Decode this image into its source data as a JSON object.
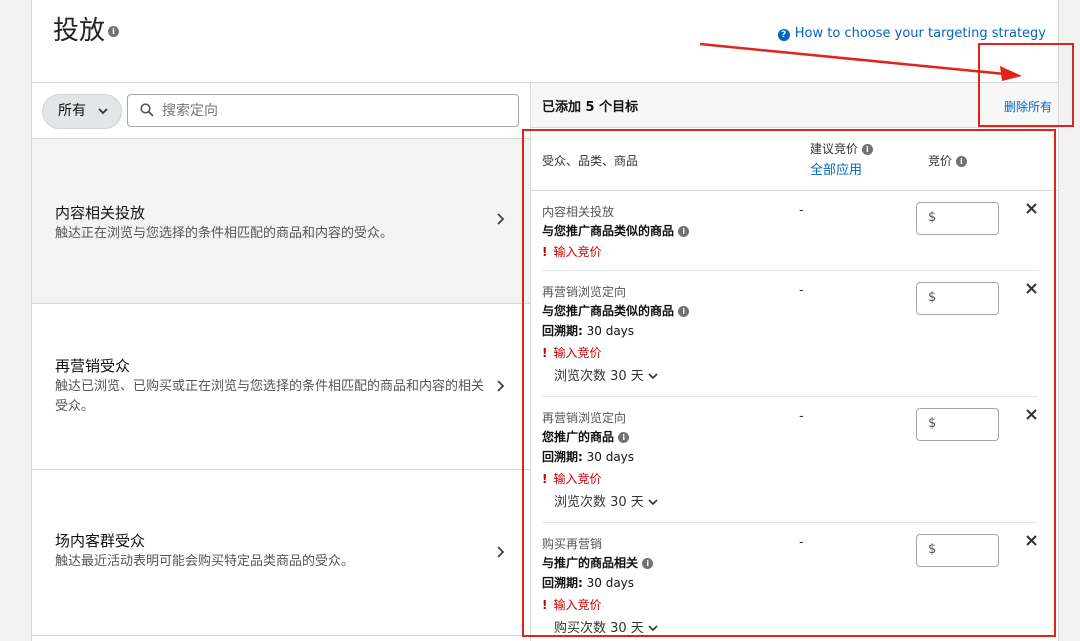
{
  "header": {
    "title": "投放",
    "help_link": "How to choose your targeting strategy"
  },
  "filter": {
    "all_label": "所有",
    "search_placeholder": "搜索定向"
  },
  "categories": [
    {
      "name": "内容相关投放",
      "desc": "触达正在浏览与您选择的条件相匹配的商品和内容的受众。"
    },
    {
      "name": "再营销受众",
      "desc": "触达已浏览、已购买或正在浏览与您选择的条件相匹配的商品和内容的相关受众。"
    },
    {
      "name": "场内客群受众",
      "desc": "触达最近活动表明可能会购买特定品类商品的受众。"
    }
  ],
  "added_panel": {
    "added_label": "已添加 5 个目标",
    "remove_all": "删除所有",
    "col_target": "受众、品类、商品",
    "col_suggested": "建议竞价",
    "apply_all": "全部应用",
    "col_bid": "竞价"
  },
  "rows": [
    {
      "type": "内容相关投放",
      "target": "与您推广商品类似的商品",
      "lookback_label": "",
      "lookback_value": "",
      "error": "输入竞价",
      "freq": "",
      "suggested": "-",
      "currency": "$"
    },
    {
      "type": "再营销浏览定向",
      "target": "与您推广商品类似的商品",
      "lookback_label": "回溯期:",
      "lookback_value": " 30 days",
      "error": "输入竞价",
      "freq": "浏览次数 30 天",
      "suggested": "-",
      "currency": "$"
    },
    {
      "type": "再营销浏览定向",
      "target": "您推广的商品",
      "lookback_label": "回溯期:",
      "lookback_value": " 30 days",
      "error": "输入竞价",
      "freq": "浏览次数 30 天",
      "suggested": "-",
      "currency": "$"
    },
    {
      "type": "购买再营销",
      "target": "与推广的商品相关",
      "lookback_label": "回溯期:",
      "lookback_value": " 30 days",
      "error": "输入竞价",
      "freq": "购买次数 30 天",
      "suggested": "-",
      "currency": "$"
    }
  ],
  "colors": {
    "link": "#0066c0",
    "error": "#c40000",
    "annotation": "#e0231c"
  }
}
